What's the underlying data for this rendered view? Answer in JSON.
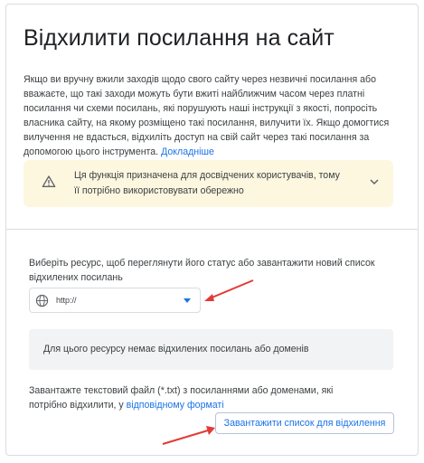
{
  "page": {
    "title": "Відхилити посилання на сайт",
    "intro": "Якщо ви вручну вжили заходів щодо свого сайту через незвичні посилання або вважаєте, що такі заходи можуть бути вжиті найближчим часом через платні посилання чи схеми посилань, які порушують наші інструкції з якості, попросіть власника сайту, на якому розміщено такі посилання, вилучити їх. Якщо домогтися вилучення не вдасться, відхиліть доступ на свій сайт через такі посилання за допомогою цього інструмента.",
    "learn_more_link": "Докладніше"
  },
  "warning": {
    "text": "Ця функція призначена для досвідчених користувачів, тому її потрібно використовувати обережно",
    "icon": "warning-triangle-icon",
    "toggle_icon": "chevron-down-icon",
    "background": "#fef7e0"
  },
  "resource": {
    "label": "Виберіть ресурс, щоб переглянути його статус або завантажити новий список відхилених посилань",
    "selected_value": "http://",
    "icon": "globe-icon"
  },
  "empty_state": {
    "text": "Для цього ресурсу немає відхилених посилань або доменів"
  },
  "upload": {
    "text_before": "Завантажте текстовий файл (*.txt) з посиланнями або доменами, які потрібно відхилити, у ",
    "format_link": "відповідному форматі",
    "button_label": "Завантажити список для відхилення"
  },
  "colors": {
    "accent": "#1a73e8",
    "annotation_arrow": "#e53935"
  }
}
